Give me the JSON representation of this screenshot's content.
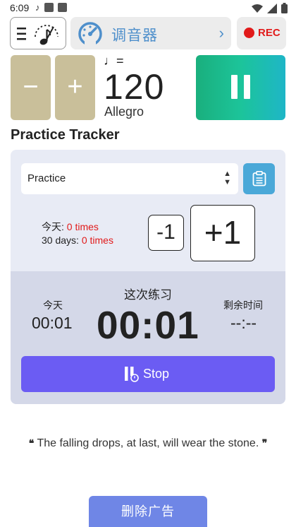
{
  "status_bar": {
    "time": "6:09",
    "left_icons": [
      "music-note-icon",
      "square-icon",
      "square-icon"
    ],
    "right_icons": [
      "wifi-icon",
      "signal-icon",
      "battery-icon"
    ]
  },
  "toolbar": {
    "menu_icon": "menu-icon",
    "metronome_icon": "metronome-icon",
    "tuner_label": "调音器",
    "tuner_icon": "gauge-icon",
    "rec_label": "REC",
    "rec_color": "#e11a1a"
  },
  "tempo": {
    "minus_label": "−",
    "plus_label": "+",
    "note_symbol": "♩=",
    "bpm": "120",
    "name": "Allegro",
    "play_state": "pause-icon",
    "gradient": [
      "#1aaf7d",
      "#1eb6c7"
    ]
  },
  "tracker": {
    "title": "Practice Tracker",
    "selected": "Practice",
    "today_prefix": "今天: ",
    "today_value": "0 times",
    "days30_prefix": "30 days: ",
    "days30_value": "0 times",
    "minus_one": "-1",
    "plus_one": "+1"
  },
  "session": {
    "today_label": "今天",
    "today_time": "00:01",
    "session_label": "这次练习",
    "session_time": "00:01",
    "remain_label": "剩余时间",
    "remain_time": "--:--",
    "stop_label": "Stop",
    "stop_color": "#6b5cf3"
  },
  "quote": {
    "open": "❝",
    "text": "The falling drops, at last, will wear the stone.",
    "close": "❞"
  },
  "footer": {
    "remove_ads": "删除广告"
  }
}
